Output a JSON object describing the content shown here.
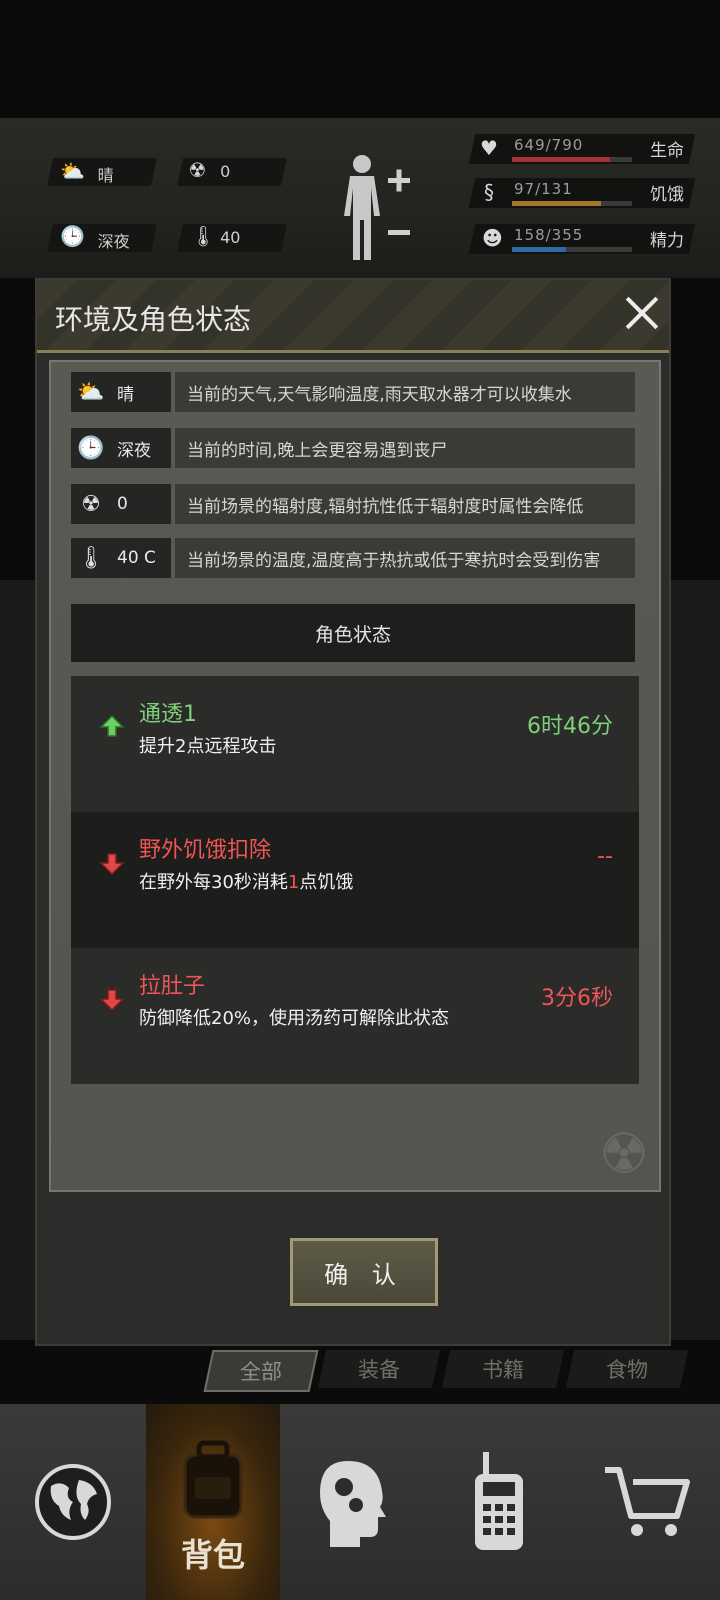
{
  "hud": {
    "weather_label": "晴",
    "radiation_value": "0",
    "time_label": "深夜",
    "temperature_value": "40",
    "stats": [
      {
        "value_text": "649/790",
        "name": "生命",
        "fraction": 0.82,
        "color": "#a83232"
      },
      {
        "value_text": "97/131",
        "name": "饥饿",
        "fraction": 0.74,
        "color": "#a7782a"
      },
      {
        "value_text": "158/355",
        "name": "精力",
        "fraction": 0.45,
        "color": "#2f6aa5"
      }
    ]
  },
  "modal": {
    "title": "环境及角色状态",
    "env_rows": [
      {
        "icon": "weather-icon",
        "key": "晴",
        "desc": "当前的天气,天气影响温度,雨天取水器才可以收集水"
      },
      {
        "icon": "clock-icon",
        "key": "深夜",
        "desc": "当前的时间,晚上会更容易遇到丧尸"
      },
      {
        "icon": "radiation-icon",
        "key": "0",
        "desc": "当前场景的辐射度,辐射抗性低于辐射度时属性会降低"
      },
      {
        "icon": "thermometer-icon",
        "key": "40 C",
        "desc": "当前场景的温度,温度高于热抗或低于寒抗时会受到伤害"
      }
    ],
    "status_header": "角色状态",
    "status_items": [
      {
        "direction": "up",
        "name": "通透1",
        "desc": "提升2点远程攻击",
        "time": "6时46分"
      },
      {
        "direction": "down",
        "name": "野外饥饿扣除",
        "desc_before": "在野外每30秒消耗",
        "desc_highlight": "1",
        "desc_after": "点饥饿",
        "time": "--"
      },
      {
        "direction": "down",
        "name": "拉肚子",
        "desc": "防御降低20%，使用汤药可解除此状态",
        "time": "3分6秒"
      }
    ],
    "confirm_label": "确 认"
  },
  "categories": [
    "全部",
    "装备",
    "书籍",
    "食物"
  ],
  "nav": {
    "items": [
      {
        "icon": "globe-icon"
      },
      {
        "icon": "backpack-icon",
        "label": "背包"
      },
      {
        "icon": "head-gears-icon"
      },
      {
        "icon": "walkie-talkie-icon"
      },
      {
        "icon": "cart-icon"
      }
    ]
  }
}
